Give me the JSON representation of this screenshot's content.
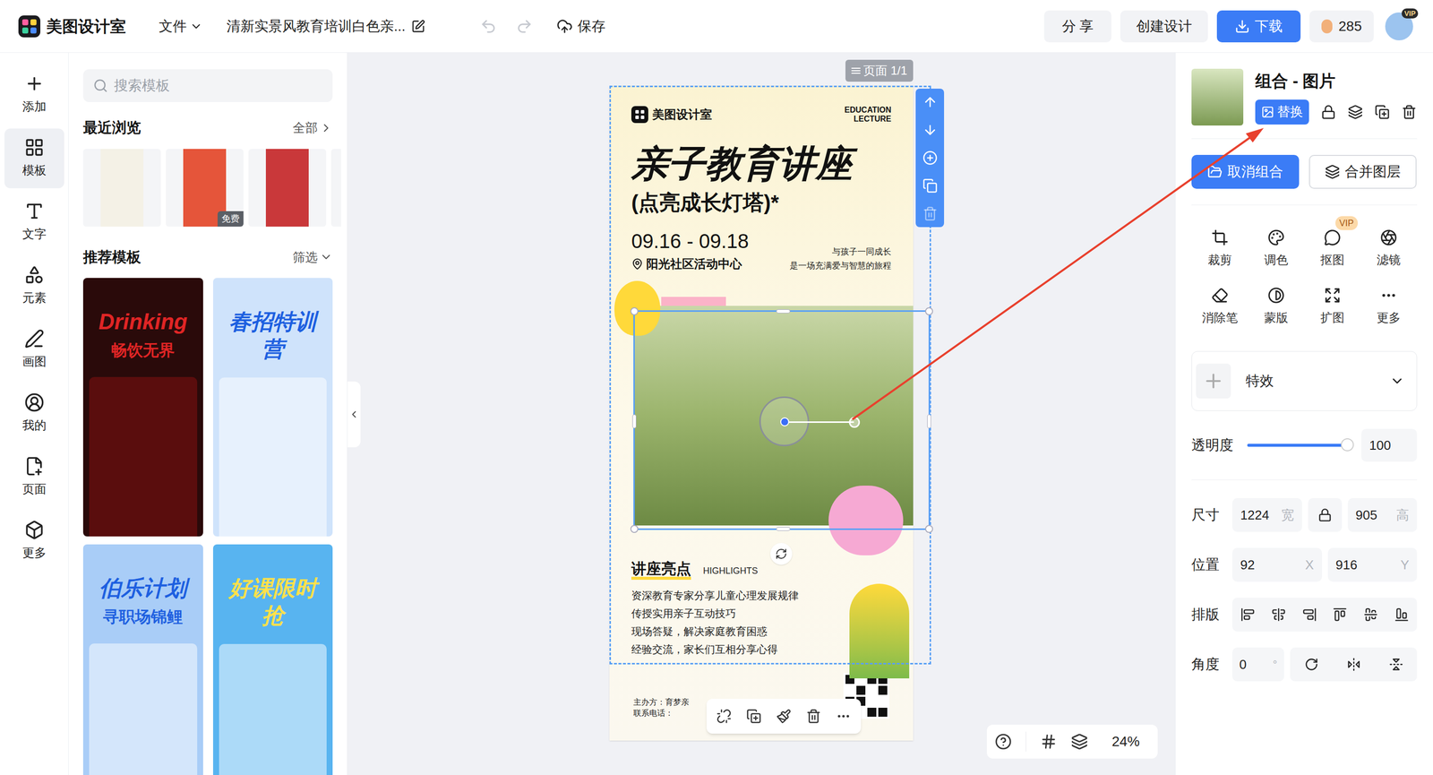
{
  "topbar": {
    "logo": "美图设计室",
    "file_menu": "文件",
    "doc_title": "清新实景风教育培训白色亲...",
    "save": "保存",
    "share": "分 享",
    "create": "创建设计",
    "download": "下载",
    "points": "285",
    "vip": "VIP"
  },
  "rail": [
    {
      "label": "添加",
      "selected": false
    },
    {
      "label": "模板",
      "selected": true
    },
    {
      "label": "文字",
      "selected": false
    },
    {
      "label": "元素",
      "selected": false
    },
    {
      "label": "画图",
      "selected": false
    },
    {
      "label": "我的",
      "selected": false
    },
    {
      "label": "页面",
      "selected": false
    },
    {
      "label": "更多",
      "selected": false
    }
  ],
  "templates": {
    "search_placeholder": "搜索模板",
    "recent_title": "最近浏览",
    "recent_all": "全部",
    "recent": [
      {
        "badge": "",
        "color": "#f4f1e6"
      },
      {
        "badge": "免费",
        "color": "#e5553a"
      },
      {
        "badge": "",
        "color": "#c9383a"
      }
    ],
    "recommended_title": "推荐模板",
    "filter": "筛选",
    "recommended": [
      {
        "title": "Drinking",
        "subtitle": "畅饮无界",
        "color": "#2a0a0a"
      },
      {
        "title": "春招特训营",
        "subtitle": "",
        "color": "#cfe3fb"
      },
      {
        "title": "伯乐计划",
        "subtitle": "寻职场锦鲤",
        "color": "#a9cdf7"
      },
      {
        "title": "好课限时抢",
        "subtitle": "",
        "color": "#58b4f0"
      }
    ]
  },
  "canvas": {
    "page_badge": "页面 1/1",
    "zoom": "24%"
  },
  "poster": {
    "logo": "美图设计室",
    "tag": [
      "EDUCATION",
      "LECTURE"
    ],
    "title": "亲子教育讲座",
    "subtitle": "(点亮成长灯塔)*",
    "date": "09.16 - 09.18",
    "location": "阳光社区活动中心",
    "slogan": [
      "与孩子一同成长",
      "是一场充满爱与智慧的旅程"
    ],
    "highlights_title": "讲座亮点",
    "highlights_en": "HIGHLIGHTS",
    "highlights": [
      "资深教育专家分享儿童心理发展规律",
      "传授实用亲子互动技巧",
      "现场答疑，解决家庭教育困惑",
      "经验交流，家长们互相分享心得"
    ],
    "host": [
      "主办方：育梦亲",
      "联系电话："
    ]
  },
  "panel": {
    "title": "组合 - 图片",
    "replace": "替换",
    "ungroup": "取消组合",
    "merge": "合并图层",
    "tools": [
      {
        "label": "裁剪",
        "badge": ""
      },
      {
        "label": "调色",
        "badge": ""
      },
      {
        "label": "抠图",
        "badge": "VIP"
      },
      {
        "label": "滤镜",
        "badge": ""
      },
      {
        "label": "消除笔",
        "badge": ""
      },
      {
        "label": "蒙版",
        "badge": ""
      },
      {
        "label": "扩图",
        "badge": ""
      },
      {
        "label": "更多",
        "badge": ""
      }
    ],
    "effects": "特效",
    "opacity": {
      "label": "透明度",
      "level": 1,
      "value": "100"
    },
    "size": {
      "label": "尺寸",
      "w": "1224",
      "w_unit": "宽",
      "h": "905",
      "h_unit": "高"
    },
    "position": {
      "label": "位置",
      "x": "92",
      "x_unit": "X",
      "y": "916",
      "y_unit": "Y"
    },
    "layout": {
      "label": "排版"
    },
    "angle": {
      "label": "角度",
      "value": "0",
      "unit": "°"
    }
  }
}
